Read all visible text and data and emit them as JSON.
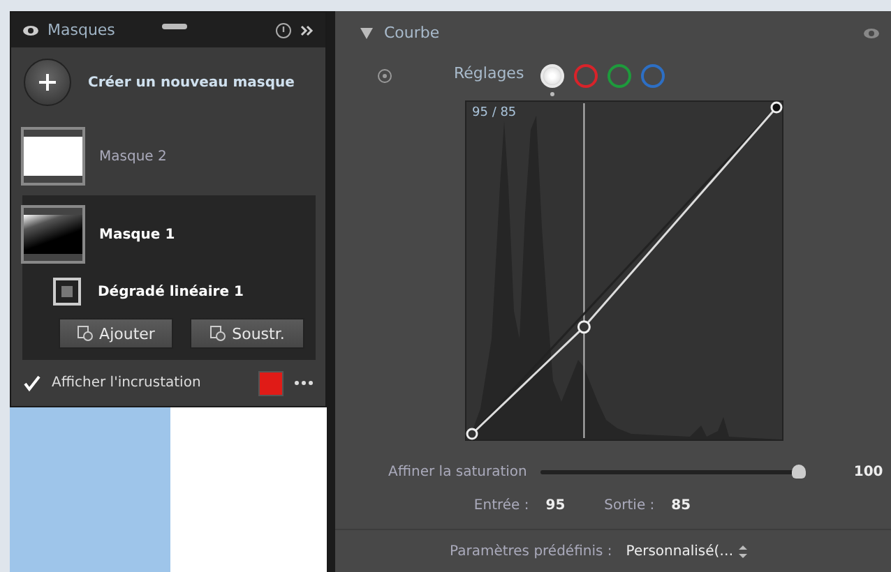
{
  "masks_panel": {
    "title": "Masques",
    "create_label": "Créer un nouveau masque",
    "masks": [
      {
        "name": "Masque 2",
        "selected": false,
        "kind": "white"
      },
      {
        "name": "Masque 1",
        "selected": true,
        "kind": "gradient",
        "children": [
          {
            "name": "Dégradé linéaire 1"
          }
        ]
      }
    ],
    "buttons": [
      "Ajouter",
      "Soustr."
    ],
    "overlay": {
      "label": "Afficher l'incrustation",
      "checked": true,
      "color": "#e01b17"
    }
  },
  "curve_panel": {
    "title": "Courbe",
    "expanded": true,
    "adjust_label": "Réglages",
    "channels": [
      {
        "color": "#e8e8e8",
        "selected": true
      },
      {
        "color": "#d8232a",
        "selected": false
      },
      {
        "color": "#1e9a3c",
        "selected": false
      },
      {
        "color": "#2d6fc4",
        "selected": false
      }
    ],
    "readout": "95 / 85",
    "saturation": {
      "label": "Affiner la saturation",
      "level": 0.99,
      "value": "100"
    },
    "input_label": "Entrée :",
    "input_value": "95",
    "output_label": "Sortie :",
    "output_value": "85",
    "presets_label": "Paramètres prédéfinis :",
    "preset_value": "Personnalisé(…"
  }
}
